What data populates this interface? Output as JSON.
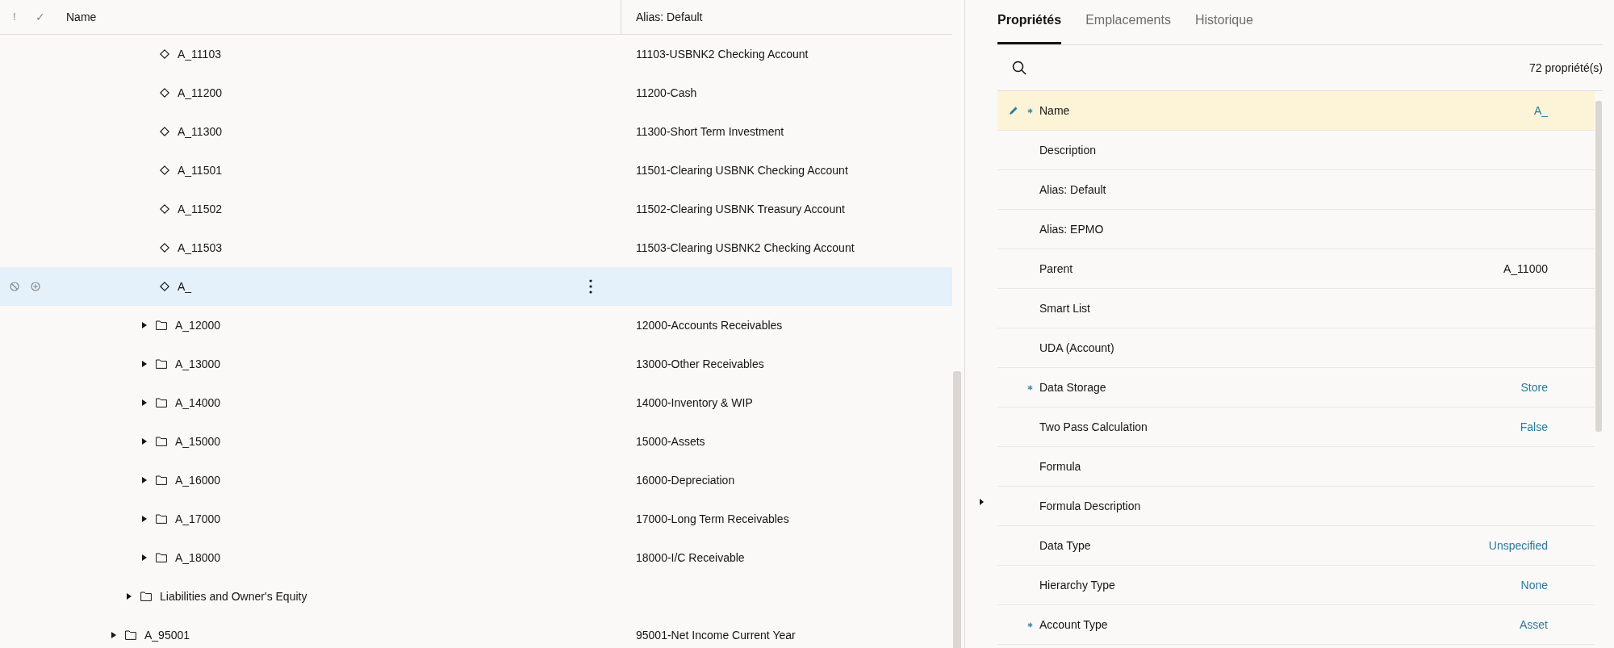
{
  "tree": {
    "columns": [
      {
        "kind": "flag",
        "label": "!"
      },
      {
        "kind": "check",
        "label": "✓"
      },
      {
        "kind": "name",
        "label": "Name"
      },
      {
        "kind": "alias",
        "label": "Alias: Default"
      }
    ],
    "rows": [
      {
        "children": [
          {
            "children": [
              {
                "children": [
                  {
                    "kind": "member",
                    "name": "A_11103",
                    "alias": "11103-USBNK2 Checking Account",
                    "selected": false
                  },
                  {
                    "kind": "member",
                    "name": "A_11200",
                    "alias": "11200-Cash",
                    "selected": false
                  },
                  {
                    "kind": "member",
                    "name": "A_11300",
                    "alias": "11300-Short Term Investment",
                    "selected": false
                  },
                  {
                    "kind": "member",
                    "name": "A_11501",
                    "alias": "11501-Clearing USBNK Checking Account",
                    "selected": false
                  },
                  {
                    "kind": "member",
                    "name": "A_11502",
                    "alias": "11502-Clearing USBNK Treasury Account",
                    "selected": false
                  },
                  {
                    "kind": "member",
                    "name": "A_11503",
                    "alias": "11503-Clearing USBNK2 Checking Account",
                    "selected": false
                  },
                  {
                    "kind": "member",
                    "name": "A_",
                    "selected": true
                  }
                ]
              },
              {
                "kind": "folder",
                "name": "A_12000",
                "alias": "12000-Accounts Receivables",
                "selected": false,
                "expanded": false
              },
              {
                "kind": "folder",
                "name": "A_13000",
                "alias": "13000-Other Receivables",
                "selected": false,
                "expanded": false
              },
              {
                "kind": "folder",
                "name": "A_14000",
                "alias": "14000-Inventory & WIP",
                "selected": false,
                "expanded": false
              },
              {
                "kind": "folder",
                "name": "A_15000",
                "alias": "15000-Assets",
                "selected": false,
                "expanded": false
              },
              {
                "kind": "folder",
                "name": "A_16000",
                "alias": "16000-Depreciation",
                "selected": false,
                "expanded": false
              },
              {
                "kind": "folder",
                "name": "A_17000",
                "alias": "17000-Long Term Receivables",
                "selected": false,
                "expanded": false
              },
              {
                "kind": "folder",
                "name": "A_18000",
                "alias": "18000-I/C Receivable",
                "selected": false,
                "expanded": false
              }
            ]
          },
          {
            "kind": "folder",
            "name": "Liabilities and Owner's Equity",
            "selected": false,
            "expanded": false
          }
        ]
      },
      {
        "kind": "folder",
        "name": "A_95001",
        "alias": "95001-Net Income Current Year",
        "selected": false,
        "expanded": false
      }
    ]
  },
  "properties_panel": {
    "tabs": [
      {
        "label": "Propriétés",
        "selected": true
      },
      {
        "label": "Emplacements",
        "selected": false
      },
      {
        "label": "Historique",
        "selected": false
      }
    ],
    "count": "72 propriété(s)",
    "properties": [
      {
        "label": "Name",
        "value": "A_",
        "required": true,
        "selected": true,
        "linked": true
      },
      {
        "label": "Description",
        "required": false,
        "selected": false
      },
      {
        "label": "Alias: Default",
        "required": false,
        "selected": false
      },
      {
        "label": "Alias: EPMO",
        "required": false,
        "selected": false
      },
      {
        "label": "Parent",
        "value": "A_11000",
        "required": false,
        "selected": false,
        "linked": false
      },
      {
        "label": "Smart List",
        "required": false,
        "selected": false
      },
      {
        "label": "UDA (Account)",
        "required": false,
        "selected": false
      },
      {
        "label": "Data Storage",
        "value": "Store",
        "required": true,
        "selected": false,
        "linked": true
      },
      {
        "label": "Two Pass Calculation",
        "value": "False",
        "required": false,
        "selected": false,
        "linked": true
      },
      {
        "label": "Formula",
        "required": false,
        "selected": false
      },
      {
        "label": "Formula Description",
        "required": false,
        "selected": false
      },
      {
        "label": "Data Type",
        "value": "Unspecified",
        "required": false,
        "selected": false,
        "linked": true
      },
      {
        "label": "Hierarchy Type",
        "value": "None",
        "required": false,
        "selected": false,
        "linked": true
      },
      {
        "label": "Account Type",
        "value": "Asset",
        "required": true,
        "selected": false,
        "linked": true
      }
    ]
  }
}
